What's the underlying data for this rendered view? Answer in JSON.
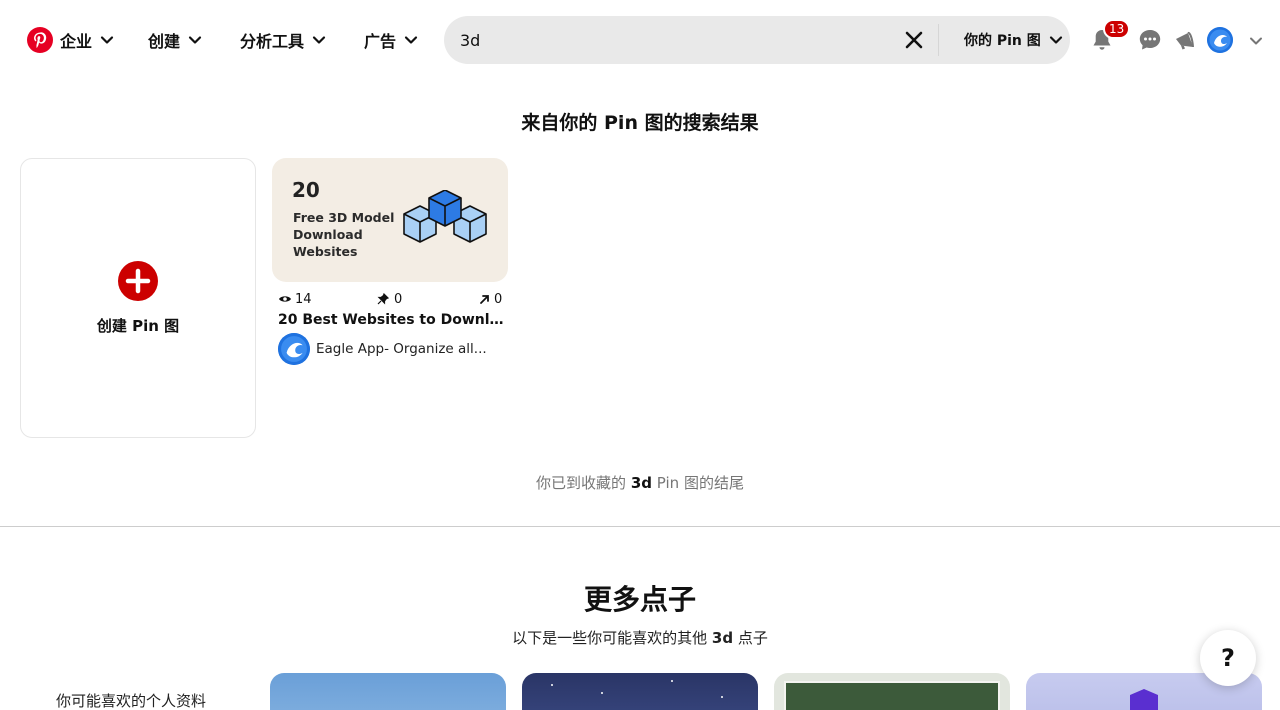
{
  "header": {
    "nav": [
      {
        "label": "企业"
      },
      {
        "label": "创建"
      },
      {
        "label": "分析工具"
      },
      {
        "label": "广告"
      }
    ],
    "search": {
      "value": "3d",
      "scope_label": "你的 Pin 图"
    },
    "notifications_count": "13",
    "icons": [
      "pinterest-logo-icon",
      "close-icon",
      "bell-icon",
      "chat-icon",
      "megaphone-icon",
      "avatar",
      "chevron-down-icon"
    ]
  },
  "results": {
    "title": "来自你的 Pin 图的搜索结果",
    "create_label": "创建 Pin 图",
    "pins": [
      {
        "image_number": "20",
        "image_lines": [
          "Free 3D Model",
          "Download",
          "Websites"
        ],
        "views": "14",
        "saves": "0",
        "clicks": "0",
        "title": "20 Best Websites to Download...",
        "author": "Eagle App- Organize all..."
      }
    ],
    "end_note_prefix": "你已到收藏的",
    "end_note_query": "3d",
    "end_note_suffix": "Pin 图的结尾"
  },
  "more_ideas": {
    "title": "更多点子",
    "subtitle_prefix": "以下是一些你可能喜欢的其他",
    "subtitle_query": "3d",
    "subtitle_suffix": "点子",
    "profiles_label": "你可能喜欢的个人资料"
  },
  "help_label": "?",
  "colors": {
    "brand": "#e60023",
    "badge": "#cc0000",
    "search_bg": "#e9e9e9"
  }
}
